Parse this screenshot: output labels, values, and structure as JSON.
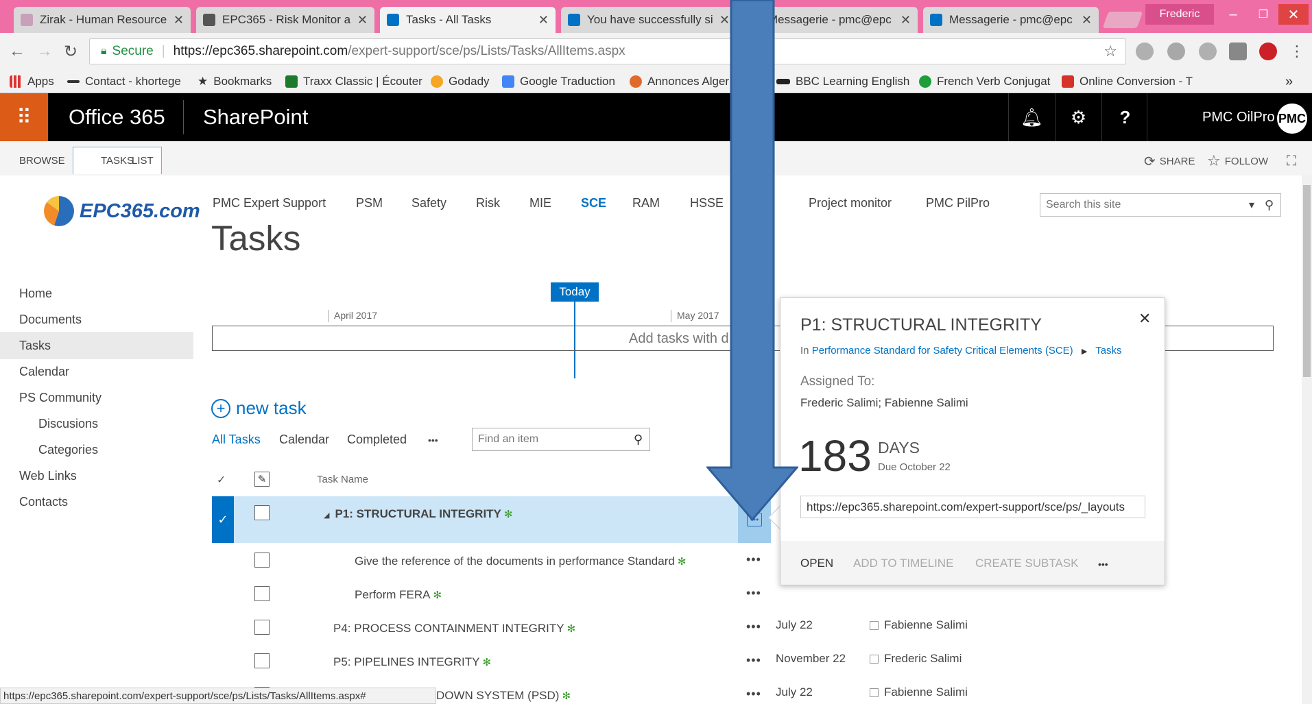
{
  "browser": {
    "tabs": [
      {
        "label": "Zirak - Human Resource",
        "favicon_color": "#c8a0b8"
      },
      {
        "label": "EPC365 - Risk Monitor a",
        "favicon_color": "#555"
      },
      {
        "label": "Tasks - All Tasks",
        "favicon_color": "#0072c6"
      },
      {
        "label": "You have successfully si",
        "favicon_color": "#0072c6"
      },
      {
        "label": "Messagerie - pmc@epc",
        "favicon_color": "#0072c6"
      },
      {
        "label": "Messagerie - pmc@epc",
        "favicon_color": "#0072c6"
      }
    ],
    "profile_name": "Frederic",
    "address": {
      "secure_label": "Secure",
      "host": "https://epc365.sharepoint.com",
      "path": "/expert-support/sce/ps/Lists/Tasks/AllItems.aspx"
    },
    "bookmarks": [
      "Apps",
      "Contact - khortege",
      "Bookmarks",
      "Traxx Classic | Écouter",
      "Godady",
      "Google Traduction",
      "Annonces Alger",
      "BBC Learning English",
      "French Verb Conjugat",
      "Online Conversion - T"
    ],
    "bookmarks_overflow": "»",
    "status_url": "https://epc365.sharepoint.com/expert-support/sce/ps/Lists/Tasks/AllItems.aspx#"
  },
  "suitebar": {
    "brand": "Office 365",
    "app": "SharePoint",
    "user_name": "PMC OilPro",
    "user_initials": "PMC"
  },
  "ribbon": {
    "tabs": [
      "BROWSE",
      "TASKS",
      "LIST"
    ],
    "share_label": "SHARE",
    "follow_label": "FOLLOW"
  },
  "site": {
    "logo_text": "EPC365.com",
    "top_nav": [
      "PMC Expert Support",
      "PSM",
      "Safety",
      "Risk",
      "MIE",
      "SCE",
      "RAM",
      "HSSE",
      "Project monitor",
      "PMC PilPro"
    ],
    "selected_nav": "SCE",
    "search_placeholder": "Search this site",
    "page_title": "Tasks",
    "quick_launch": [
      "Home",
      "Documents",
      "Tasks",
      "Calendar",
      "PS Community",
      "Discusions",
      "Categories",
      "Web Links",
      "Contacts"
    ]
  },
  "timeline": {
    "today_label": "Today",
    "months": [
      "April 2017",
      "May 2017"
    ],
    "hint": "Add tasks with d"
  },
  "list": {
    "new_task_label": "new task",
    "views": [
      "All Tasks",
      "Calendar",
      "Completed"
    ],
    "more_views": "•••",
    "find_placeholder": "Find an item",
    "column_task_name": "Task Name",
    "rows": [
      {
        "name": "P1: STRUCTURAL INTEGRITY",
        "due": "",
        "assigned": ""
      },
      {
        "name": "Give the reference of the documents in performance Standard",
        "due": "",
        "assigned": ""
      },
      {
        "name": "Perform FERA",
        "due": "",
        "assigned": ""
      },
      {
        "name": "P4: PROCESS CONTAINMENT INTEGRITY",
        "due": "July 22",
        "assigned": "Fabienne Salimi"
      },
      {
        "name": "P5: PIPELINES INTEGRITY",
        "due": "November 22",
        "assigned": "Frederic Salimi"
      },
      {
        "name": "DOWN SYSTEM (PSD)",
        "due": "July 22",
        "assigned": "Fabienne Salimi"
      }
    ],
    "new_marker": "✻",
    "ellipsis": "•••"
  },
  "callout": {
    "title": "P1: STRUCTURAL INTEGRITY",
    "crumb_in": "In",
    "crumb_site": "Performance Standard for Safety Critical Elements (SCE)",
    "crumb_list": "Tasks",
    "assigned_label": "Assigned To:",
    "assigned_value": "Frederic Salimi; Fabienne Salimi",
    "days_number": "183",
    "days_label": "DAYS",
    "due_text": "Due October 22",
    "url": "https://epc365.sharepoint.com/expert-support/sce/ps/_layouts",
    "actions": [
      "OPEN",
      "ADD TO TIMELINE",
      "CREATE SUBTASK"
    ],
    "more": "•••"
  },
  "colors": {
    "arrow_fill": "#4a7ebb",
    "arrow_stroke": "#2f5f99",
    "accent": "#0072c6",
    "suite_orange": "#dc5b16"
  }
}
